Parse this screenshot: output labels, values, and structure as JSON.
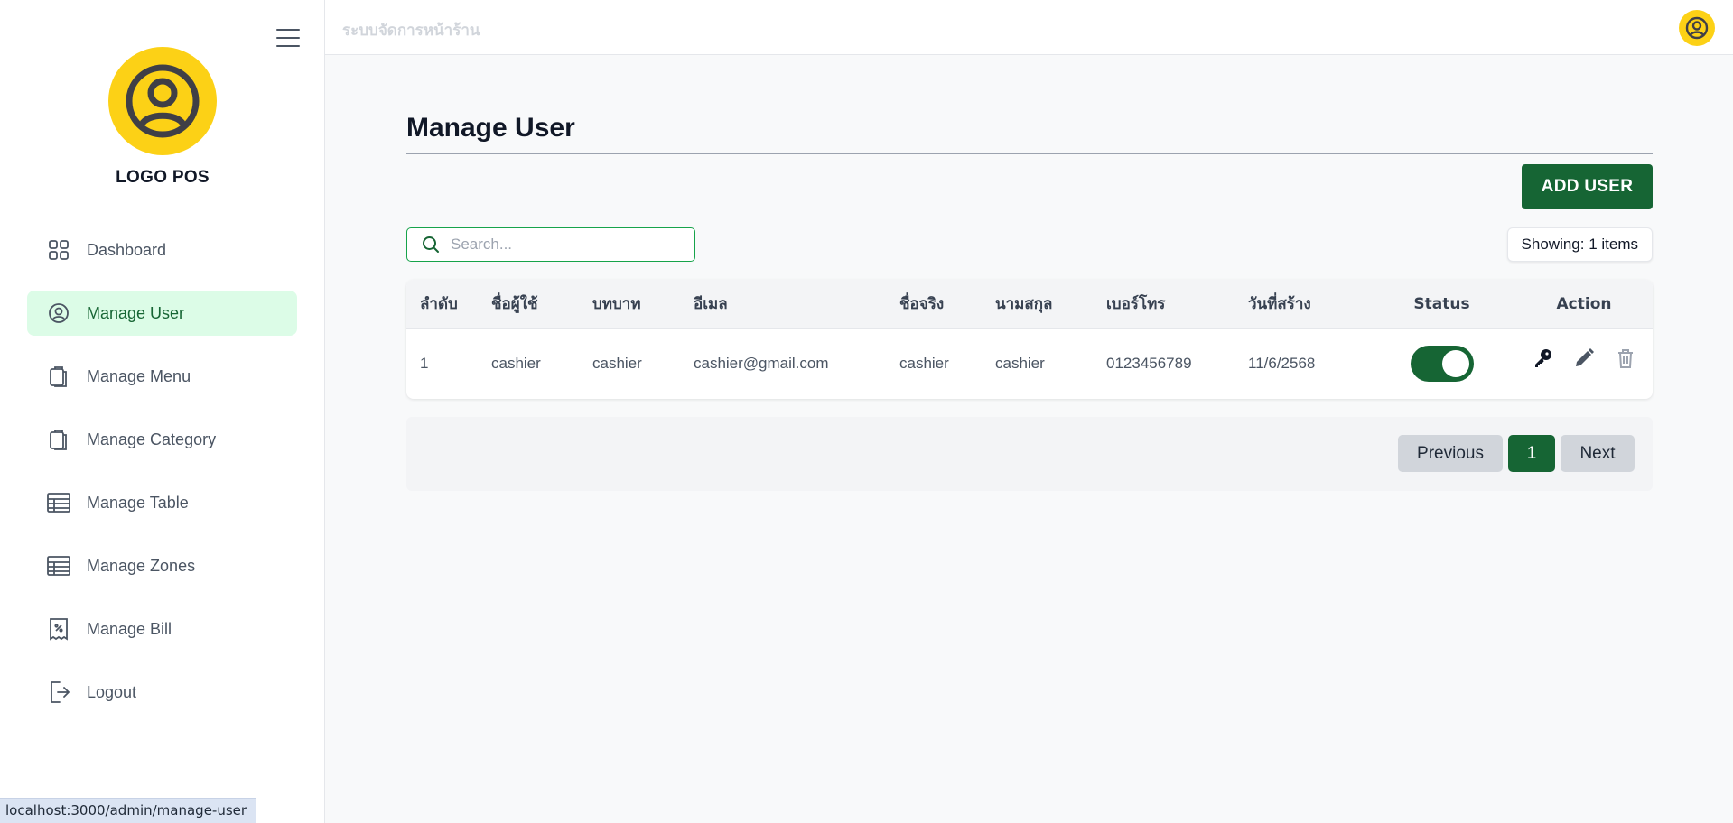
{
  "app": {
    "logo_text": "LOGO POS",
    "top_title": "ระบบจัดการหน้าร้าน",
    "status_url": "localhost:3000/admin/manage-user"
  },
  "sidebar": {
    "items": [
      {
        "label": "Dashboard",
        "icon": "dashboard-grid-icon"
      },
      {
        "label": "Manage User",
        "icon": "user-circle-icon",
        "active": true
      },
      {
        "label": "Manage Menu",
        "icon": "clipboard-icon"
      },
      {
        "label": "Manage Category",
        "icon": "clipboard-icon"
      },
      {
        "label": "Manage Table",
        "icon": "table-icon"
      },
      {
        "label": "Manage Zones",
        "icon": "table-icon"
      },
      {
        "label": "Manage Bill",
        "icon": "receipt-icon"
      },
      {
        "label": "Logout",
        "icon": "logout-icon"
      }
    ]
  },
  "main": {
    "title": "Manage User",
    "add_button": "ADD USER",
    "search_placeholder": "Search...",
    "showing": "Showing: 1 items",
    "columns": [
      "ลำดับ",
      "ชื่อผู้ใช้",
      "บทบาท",
      "อีเมล",
      "ชื่อจริง",
      "นามสกุล",
      "เบอร์โทร",
      "วันที่สร้าง",
      "Status",
      "Action"
    ],
    "rows": [
      {
        "no": "1",
        "username": "cashier",
        "role": "cashier",
        "email": "cashier@gmail.com",
        "first_name": "cashier",
        "last_name": "cashier",
        "phone": "0123456789",
        "created": "11/6/2568",
        "status_on": true
      }
    ],
    "pagination": {
      "previous": "Previous",
      "current": "1",
      "next": "Next"
    }
  },
  "colors": {
    "accent": "#166534",
    "active_bg": "#dcfce7",
    "logo_yellow": "#fcd116"
  }
}
